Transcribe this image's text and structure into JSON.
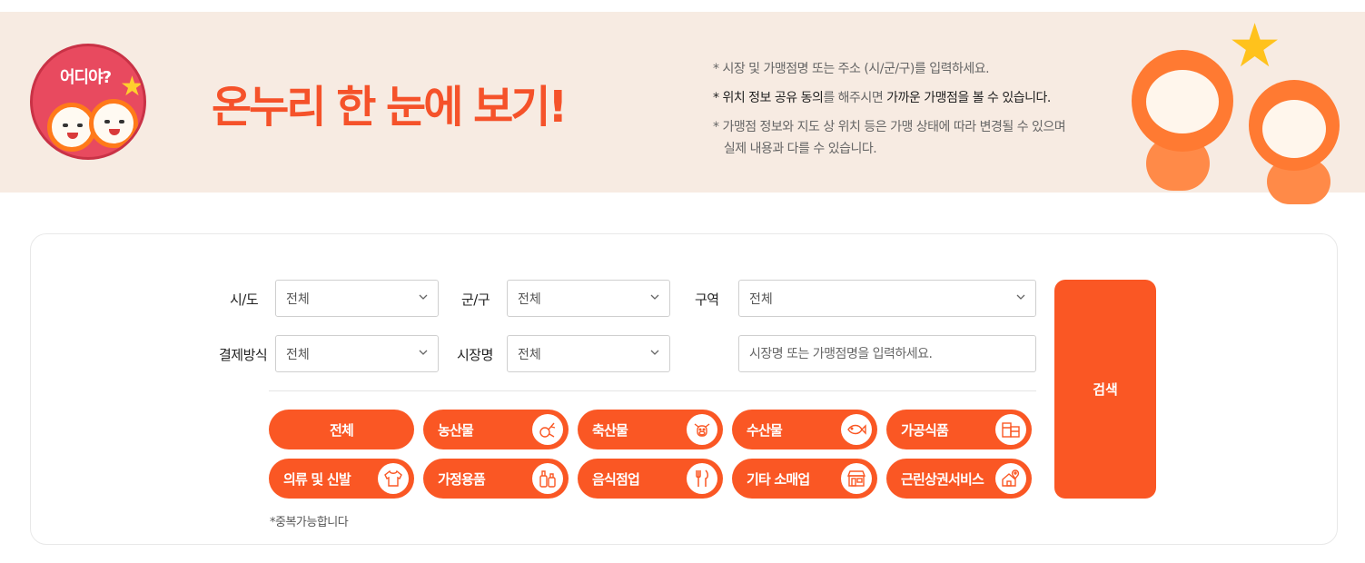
{
  "banner": {
    "logo_text": "어디야?",
    "headline": "온누리 한 눈에 보기!",
    "notes": {
      "n1": "* 시장 및 가맹점명 또는 주소 (시/군/구)를 입력하세요.",
      "n2_a": "* 위치 정보 공유 동의",
      "n2_b": "를 해주시면 ",
      "n2_c": "가까운 가맹점을 볼 수 있습니다.",
      "n3_a": "* 가맹점 정보와 지도 상 위치 등은 가맹 상태에 따라 변경될 수 있으며",
      "n3_b": "실제 내용과 다를 수 있습니다."
    }
  },
  "filters": {
    "sido": {
      "label": "시/도",
      "value": "전체"
    },
    "gungu": {
      "label": "군/구",
      "value": "전체"
    },
    "zone": {
      "label": "구역",
      "value": "전체"
    },
    "payment": {
      "label": "결제방식",
      "value": "전체"
    },
    "market": {
      "label": "시장명",
      "value": "전체"
    },
    "keyword_placeholder": "시장명 또는 가맹점명을 입력하세요."
  },
  "categories": [
    {
      "label": "전체",
      "icon": "none"
    },
    {
      "label": "농산물",
      "icon": "vegetable-icon"
    },
    {
      "label": "축산물",
      "icon": "cow-icon"
    },
    {
      "label": "수산물",
      "icon": "fish-icon"
    },
    {
      "label": "가공식품",
      "icon": "packaged-food-icon"
    },
    {
      "label": "의류 및 신발",
      "icon": "shirt-icon"
    },
    {
      "label": "가정용품",
      "icon": "bottles-icon"
    },
    {
      "label": "음식점업",
      "icon": "fork-knife-icon"
    },
    {
      "label": "기타 소매업",
      "icon": "store-icon"
    },
    {
      "label": "근린상권서비스",
      "icon": "location-house-icon"
    }
  ],
  "multi_note": "*중복가능합니다",
  "search_label": "검색",
  "colors": {
    "accent": "#fa5724",
    "banner_bg": "#f7ebe2",
    "headline": "#f5522a"
  }
}
